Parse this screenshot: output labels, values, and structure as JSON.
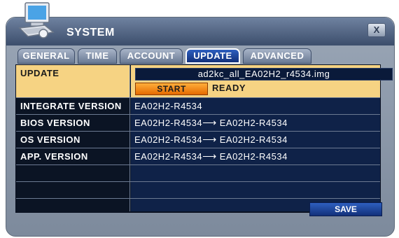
{
  "window": {
    "title": "SYSTEM",
    "close_label": "X"
  },
  "tabs": [
    {
      "label": "GENERAL",
      "active": false
    },
    {
      "label": "TIME",
      "active": false
    },
    {
      "label": "ACCOUNT",
      "active": false
    },
    {
      "label": "UPDATE",
      "active": true
    },
    {
      "label": "ADVANCED",
      "active": false
    }
  ],
  "update": {
    "label": "UPDATE",
    "filename": "ad2kc_all_EA02H2_r4534.img",
    "start_label": "START",
    "status": "READY"
  },
  "rows": [
    {
      "label": "INTEGRATE VERSION",
      "value": "EA02H2-R4534"
    },
    {
      "label": "BIOS VERSION",
      "value": "EA02H2-R4534",
      "arrow": "⟶",
      "new_value": "EA02H2-R4534"
    },
    {
      "label": "OS VERSION",
      "value": "EA02H2-R4534",
      "arrow": "⟶",
      "new_value": "EA02H2-R4534"
    },
    {
      "label": "APP. VERSION",
      "value": "EA02H2-R4534",
      "arrow": "⟶",
      "new_value": "EA02H2-R4534"
    }
  ],
  "buttons": {
    "save_label": "SAVE"
  },
  "icons": {
    "window_logo": "computer-icon"
  },
  "colors": {
    "accent": "#12307a",
    "highlight": "#f6d383",
    "start": "#e56a00"
  }
}
